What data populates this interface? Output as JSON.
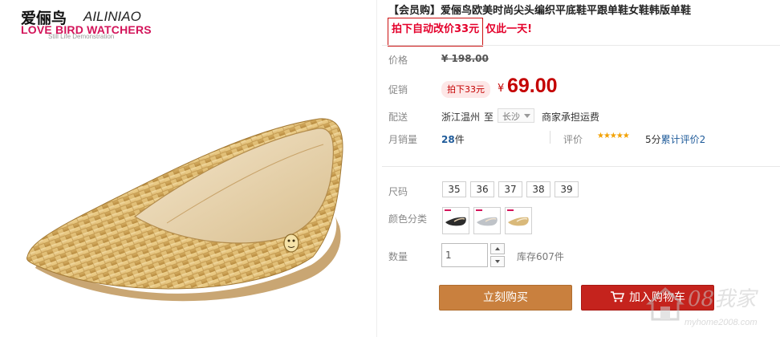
{
  "brand": {
    "logo_cn": "爱俪鸟",
    "logo_en": "AILINIAO",
    "logo_tagline": "LOVE BIRD WATCHERS",
    "logo_subtitle": "Still Life Demonstration",
    "tagline_color": "#d3145a"
  },
  "product": {
    "title": "【会员购】爱俪鸟欧美时尚尖头编织平底鞋平跟单鞋女鞋韩版单鞋",
    "promo_boxed": "拍下自动改价33元",
    "promo_rest": "仅此一天!",
    "accent_color": "#c40000"
  },
  "price": {
    "label": "价格",
    "original": "¥ 198.00"
  },
  "promotion": {
    "label": "促销",
    "badge": "拍下33元",
    "currency": "¥",
    "sale_price": "69.00"
  },
  "shipping": {
    "label": "配送",
    "from": "浙江温州",
    "to_word": "至",
    "destination": "长沙",
    "note": "商家承担运费"
  },
  "sales": {
    "label": "月销量",
    "count": "28",
    "unit": "件",
    "rating_label": "评价",
    "stars": "★★★★★",
    "rating_prefix": "5分",
    "review_link": "累计评价2"
  },
  "sizes": {
    "label": "尺码",
    "options": [
      "35",
      "36",
      "37",
      "38",
      "39"
    ]
  },
  "colors": {
    "label": "颜色分类",
    "swatches": [
      {
        "icon": "black-shoe-icon",
        "color": "#2b2b2b"
      },
      {
        "icon": "silver-shoe-icon",
        "color": "#bfc3c8"
      },
      {
        "icon": "gold-shoe-icon",
        "color": "#d9b97a"
      }
    ]
  },
  "quantity": {
    "label": "数量",
    "value": "1",
    "stock": "库存607件"
  },
  "actions": {
    "buy_now": "立刻购买",
    "add_to_cart": "加入购物车",
    "buy_color": "#c9803e",
    "cart_color": "#c5231d"
  },
  "watermark": {
    "text": "08我家",
    "url": "myhome2008.com"
  }
}
